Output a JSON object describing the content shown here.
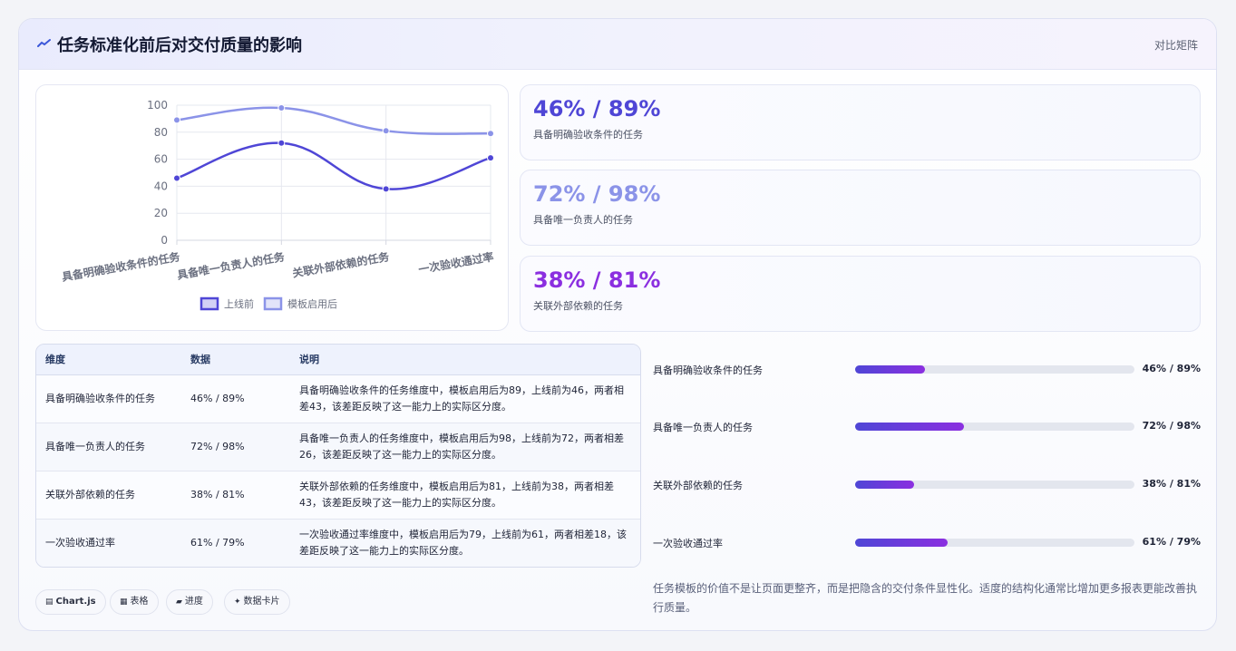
{
  "header": {
    "title": "任务标准化前后对交付质量的影响",
    "tag": "对比矩阵",
    "icon": "trend-line-icon"
  },
  "chart_data": {
    "type": "line",
    "categories": [
      "具备明确验收条件的任务",
      "具备唯一负责人的任务",
      "关联外部依赖的任务",
      "一次验收通过率"
    ],
    "series": [
      {
        "name": "上线前",
        "values": [
          46,
          72,
          38,
          61
        ],
        "color": "#4f46d6"
      },
      {
        "name": "模板启用后",
        "values": [
          89,
          98,
          81,
          79
        ],
        "color": "#8b93e8"
      }
    ],
    "yticks": [
      "0",
      "20",
      "40",
      "60",
      "80",
      "100"
    ],
    "ylim": [
      0,
      100
    ],
    "legend": "bottom",
    "grid": true
  },
  "stats": [
    {
      "value": "46% / 89%",
      "label": "具备明确验收条件的任务",
      "color": "#4f46d6"
    },
    {
      "value": "72% / 98%",
      "label": "具备唯一负责人的任务",
      "color": "#8b93e8"
    },
    {
      "value": "38% / 81%",
      "label": "关联外部依赖的任务",
      "color": "#8b2fe0"
    }
  ],
  "table": {
    "headers": [
      "维度",
      "数据",
      "说明"
    ],
    "rows": [
      {
        "dim": "具备明确验收条件的任务",
        "data": "46% / 89%",
        "desc": "具备明确验收条件的任务维度中，模板启用后为89，上线前为46，两者相差43，该差距反映了这一能力上的实际区分度。"
      },
      {
        "dim": "具备唯一负责人的任务",
        "data": "72% / 98%",
        "desc": "具备唯一负责人的任务维度中，模板启用后为98，上线前为72，两者相差26，该差距反映了这一能力上的实际区分度。"
      },
      {
        "dim": "关联外部依赖的任务",
        "data": "38% / 81%",
        "desc": "关联外部依赖的任务维度中，模板启用后为81，上线前为38，两者相差43，该差距反映了这一能力上的实际区分度。"
      },
      {
        "dim": "一次验收通过率",
        "data": "61% / 79%",
        "desc": "一次验收通过率维度中，模板启用后为79，上线前为61，两者相差18，该差距反映了这一能力上的实际区分度。"
      }
    ]
  },
  "progress": [
    {
      "label": "具备明确验收条件的任务",
      "value": "46% / 89%",
      "fraction": 0.25
    },
    {
      "label": "具备唯一负责人的任务",
      "value": "72% / 98%",
      "fraction": 0.39
    },
    {
      "label": "关联外部依赖的任务",
      "value": "38% / 81%",
      "fraction": 0.21
    },
    {
      "label": "一次验收通过率",
      "value": "61% / 79%",
      "fraction": 0.33
    }
  ],
  "note": "任务模板的价值不是让页面更整齐，而是把隐含的交付条件显性化。适度的结构化通常比增加更多报表更能改善执行质量。",
  "chips": [
    {
      "icon": "chart-icon",
      "glyph": "▤",
      "label": "Chart.js"
    },
    {
      "icon": "table-icon",
      "glyph": "▦",
      "label": "表格"
    },
    {
      "icon": "progress-icon",
      "glyph": "▰",
      "label": "进度"
    },
    {
      "icon": "card-icon",
      "glyph": "✦",
      "label": "数据卡片"
    }
  ]
}
